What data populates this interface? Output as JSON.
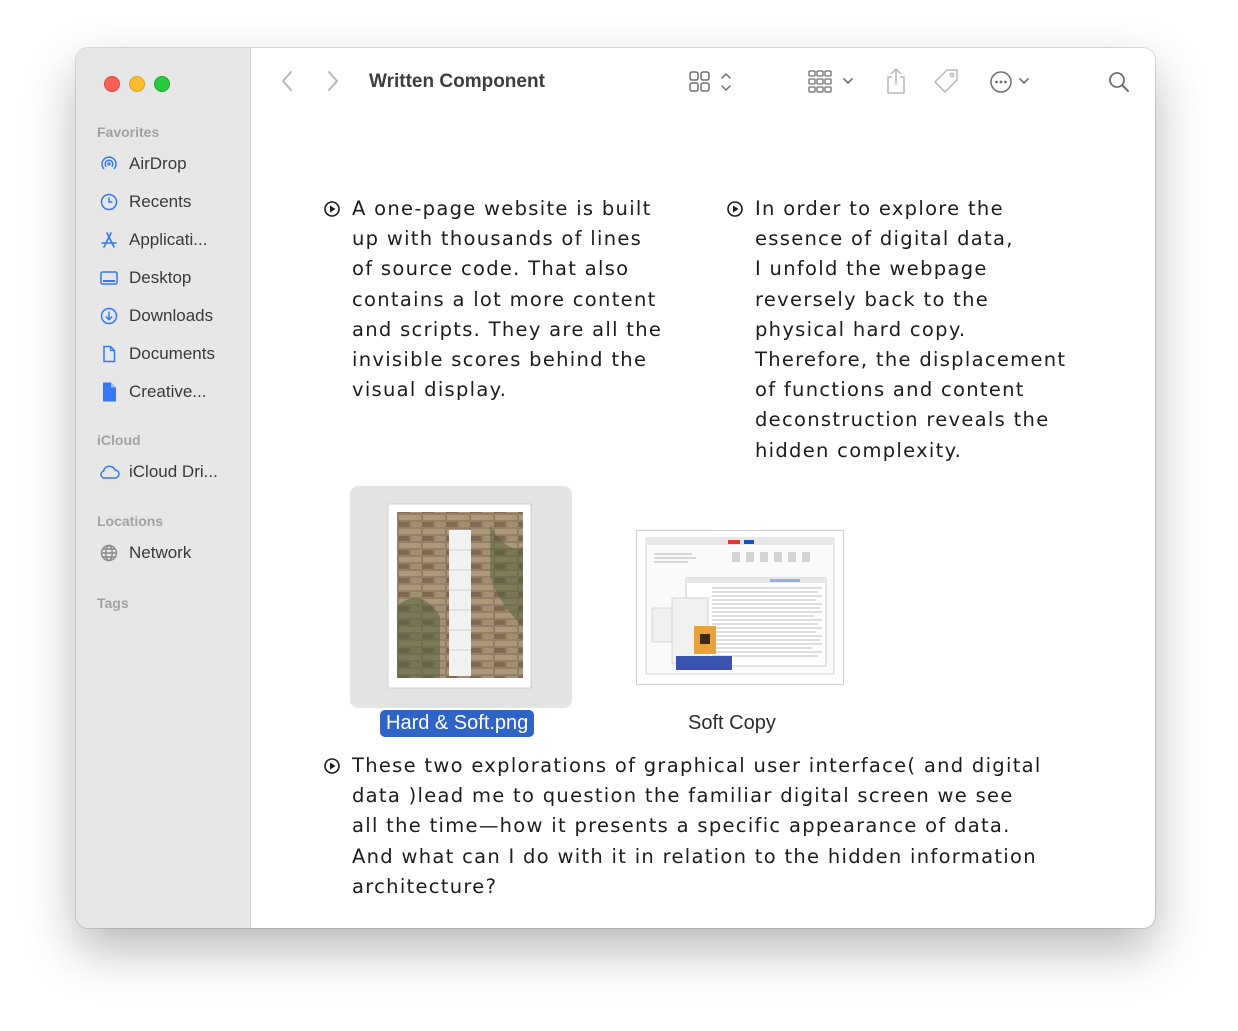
{
  "toolbar": {
    "title": "Written Component"
  },
  "sidebar": {
    "sections": [
      {
        "label": "Favorites"
      },
      {
        "label": "iCloud"
      },
      {
        "label": "Locations"
      },
      {
        "label": "Tags"
      }
    ],
    "favorites": [
      {
        "label": "AirDrop",
        "icon": "airdrop-icon"
      },
      {
        "label": "Recents",
        "icon": "clock-icon"
      },
      {
        "label": "Applicati...",
        "icon": "applications-icon"
      },
      {
        "label": "Desktop",
        "icon": "desktop-icon"
      },
      {
        "label": "Downloads",
        "icon": "downloads-icon"
      },
      {
        "label": "Documents",
        "icon": "document-icon"
      },
      {
        "label": "Creative...",
        "icon": "file-icon"
      }
    ],
    "icloud": [
      {
        "label": "iCloud Dri...",
        "icon": "cloud-icon"
      }
    ],
    "locations": [
      {
        "label": "Network",
        "icon": "globe-icon"
      }
    ]
  },
  "content": {
    "para1": [
      "A one-page website is built",
      "up with thousands of lines",
      "of source code. That also",
      "contains a lot more content",
      "and scripts. They are all the",
      "invisible scores behind the",
      "visual display."
    ],
    "para2": [
      "In order to explore the",
      "essence of digital data,",
      "I unfold the webpage",
      "reversely back to the",
      "physical hard copy.",
      "Therefore, the displacement",
      "of functions and content",
      "deconstruction reveals the",
      "hidden complexity."
    ],
    "para3": [
      "These two explorations of graphical user interface( and digital",
      "data )lead me to question the familiar digital screen we see",
      "all the time—how it presents a specific appearance of data.",
      "And what can I do with it in relation to the hidden information",
      "architecture?"
    ],
    "files": [
      {
        "name": "Hard & Soft.png",
        "selected": true
      },
      {
        "name": "Soft Copy",
        "selected": false
      }
    ]
  },
  "colors": {
    "selection": "#2f63c8",
    "sidebar_icon": "#3478f6",
    "sidebar_bg": "#e8e7e7"
  }
}
